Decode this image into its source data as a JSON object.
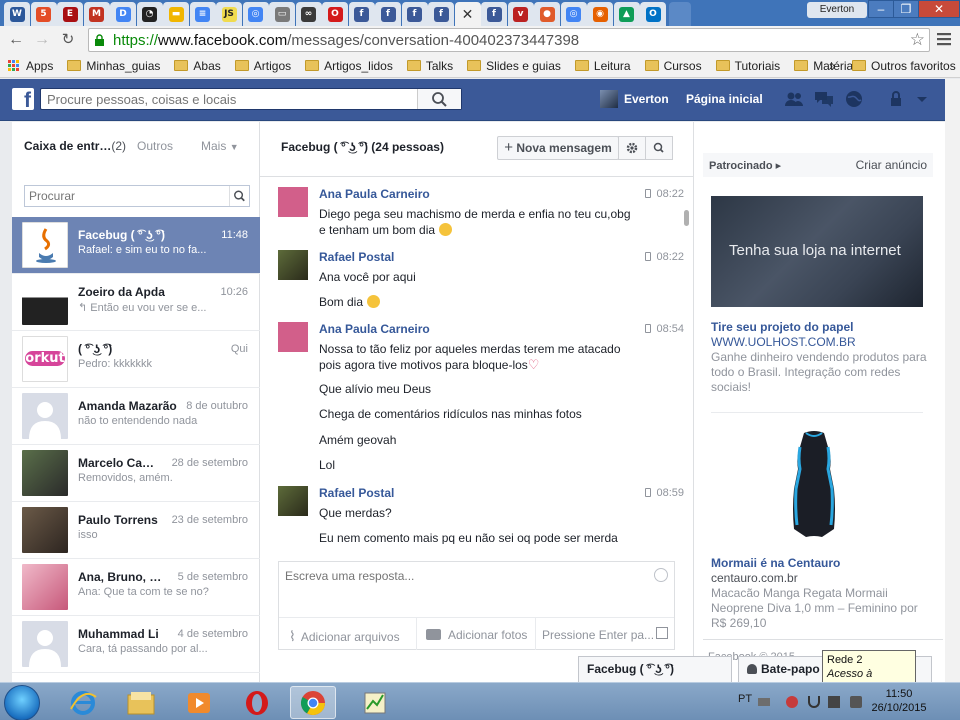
{
  "browser": {
    "url_scheme": "https://",
    "url_host": "www.facebook.com",
    "url_path": "/messages/conversation-400402373447398",
    "profile": "Everton",
    "bookmarks": [
      "Apps",
      "Minhas_guias",
      "Abas",
      "Artigos",
      "Artigos_lidos",
      "Talks",
      "Slides e guias",
      "Leitura",
      "Cursos",
      "Tutoriais",
      "Matérias"
    ],
    "more_bookmarks": "»",
    "other_bookmarks": "Outros favoritos",
    "tab_icons": [
      "word-tab-icon",
      "html5-tab-icon",
      "evernote-tab-icon",
      "gmail-tab-icon",
      "docs-tab-icon",
      "github-tab-icon",
      "slides-tab-icon",
      "docs-tab-icon-2",
      "js-tab-icon",
      "chrome-tab-icon",
      "doc-tab-icon",
      "cloud-tab-icon",
      "opera-tab-icon",
      "facebook-tab-icon",
      "facebook-tab-icon-2",
      "facebook-tab-icon-3",
      "facebook-tab-icon-4",
      "active-tab-close",
      "facebook-tab-icon-5",
      "v-tab-icon",
      "circle-tab-icon",
      "chrome-tab-icon-2",
      "firefox-tab-icon",
      "drive-tab-icon",
      "outlook-tab-icon"
    ]
  },
  "facebook": {
    "search_placeholder": "Procure pessoas, coisas e locais",
    "user_name": "Everton",
    "home_label": "Página inicial",
    "brand_color": "#3b5998"
  },
  "inbox": {
    "label": "Caixa de entr…",
    "count": "(2)",
    "others_tab": "Outros",
    "more_tab": "Mais",
    "search_placeholder": "Procurar",
    "conversations": [
      {
        "name": "Facebug ( ͡° ͜ʖ ͡°)",
        "time": "11:48",
        "snippet": "Rafael: e sim eu to no fa..."
      },
      {
        "name": "Zoeiro da Apda",
        "time": "10:26",
        "snippet": "↰ Então eu vou ver se e..."
      },
      {
        "name": "( ͡° ͜ʖ ͡°)",
        "time": "Qui",
        "snippet": "Pedro: kkkkkkk"
      },
      {
        "name": "Amanda Mazarão",
        "time": "8 de outubro",
        "snippet": "não to entendendo nada"
      },
      {
        "name": "Marcelo Ca…",
        "time": "28 de setembro",
        "snippet": "Removidos, amém."
      },
      {
        "name": "Paulo Torrens",
        "time": "23 de setembro",
        "snippet": "isso"
      },
      {
        "name": "Ana, Bruno, …",
        "time": "5 de setembro",
        "snippet": "Ana: Que ta com te se no?"
      },
      {
        "name": "Muhammad Li",
        "time": "4 de setembro",
        "snippet": "Cara, tá passando por al..."
      }
    ]
  },
  "conversation": {
    "title": "Facebug ( ͡° ͜ʖ ͡°) (24 pessoas)",
    "new_message": "Nova mensagem",
    "messages": [
      {
        "author": "Ana Paula Carneiro",
        "time": "08:22",
        "lines": [
          "Diego pega seu machismo de merda e enfia no teu cu,obg",
          "e tenham um bom dia"
        ]
      },
      {
        "author": "Rafael Postal",
        "time": "08:22",
        "lines": [
          "Ana você por aqui",
          "Bom dia"
        ]
      },
      {
        "author": "Ana Paula Carneiro",
        "time": "08:54",
        "lines": [
          "Nossa to tão feliz por aqueles merdas terem me atacado",
          "pois agora tive motivos para bloque-los",
          "Que alívio meu Deus",
          "Chega de comentários ridículos nas minhas fotos",
          "Amém geovah",
          "Lol"
        ]
      },
      {
        "author": "Rafael Postal",
        "time": "08:59",
        "lines": [
          "Que merdas?",
          "Eu nem comento mais pq eu não sei oq pode ser merda"
        ]
      }
    ],
    "reply_placeholder": "Escreva uma resposta...",
    "attach_files": "Adicionar arquivos",
    "attach_photos": "Adicionar fotos",
    "press_enter": "Pressione Enter pa..."
  },
  "sidebar": {
    "sponsored": "Patrocinado",
    "create_ad": "Criar anúncio",
    "ad1": {
      "image_text": "Tenha sua loja na internet",
      "title": "Tire seu projeto do papel",
      "url": "WWW.UOLHOST.COM.BR",
      "desc": "Ganhe dinheiro vendendo produtos para todo o Brasil. Integração com redes sociais!"
    },
    "ad2": {
      "title": "Mormaii é na Centauro",
      "url": "centauro.com.br",
      "desc": "Macacão Manga Regata Mormaii Neoprene Diva 1,0 mm – Feminino por R$ 269,10"
    },
    "copyright": "Facebook © 2015"
  },
  "chat": {
    "tab_fb": "Facebug ( ͡° ͜ʖ ͡°)",
    "tab_chat": "Bate-papo",
    "tooltip_title": "Rede  2",
    "tooltip_sub": "Acesso à Internet"
  },
  "taskbar": {
    "lang": "PT",
    "time": "11:50",
    "date": "26/10/2015"
  }
}
